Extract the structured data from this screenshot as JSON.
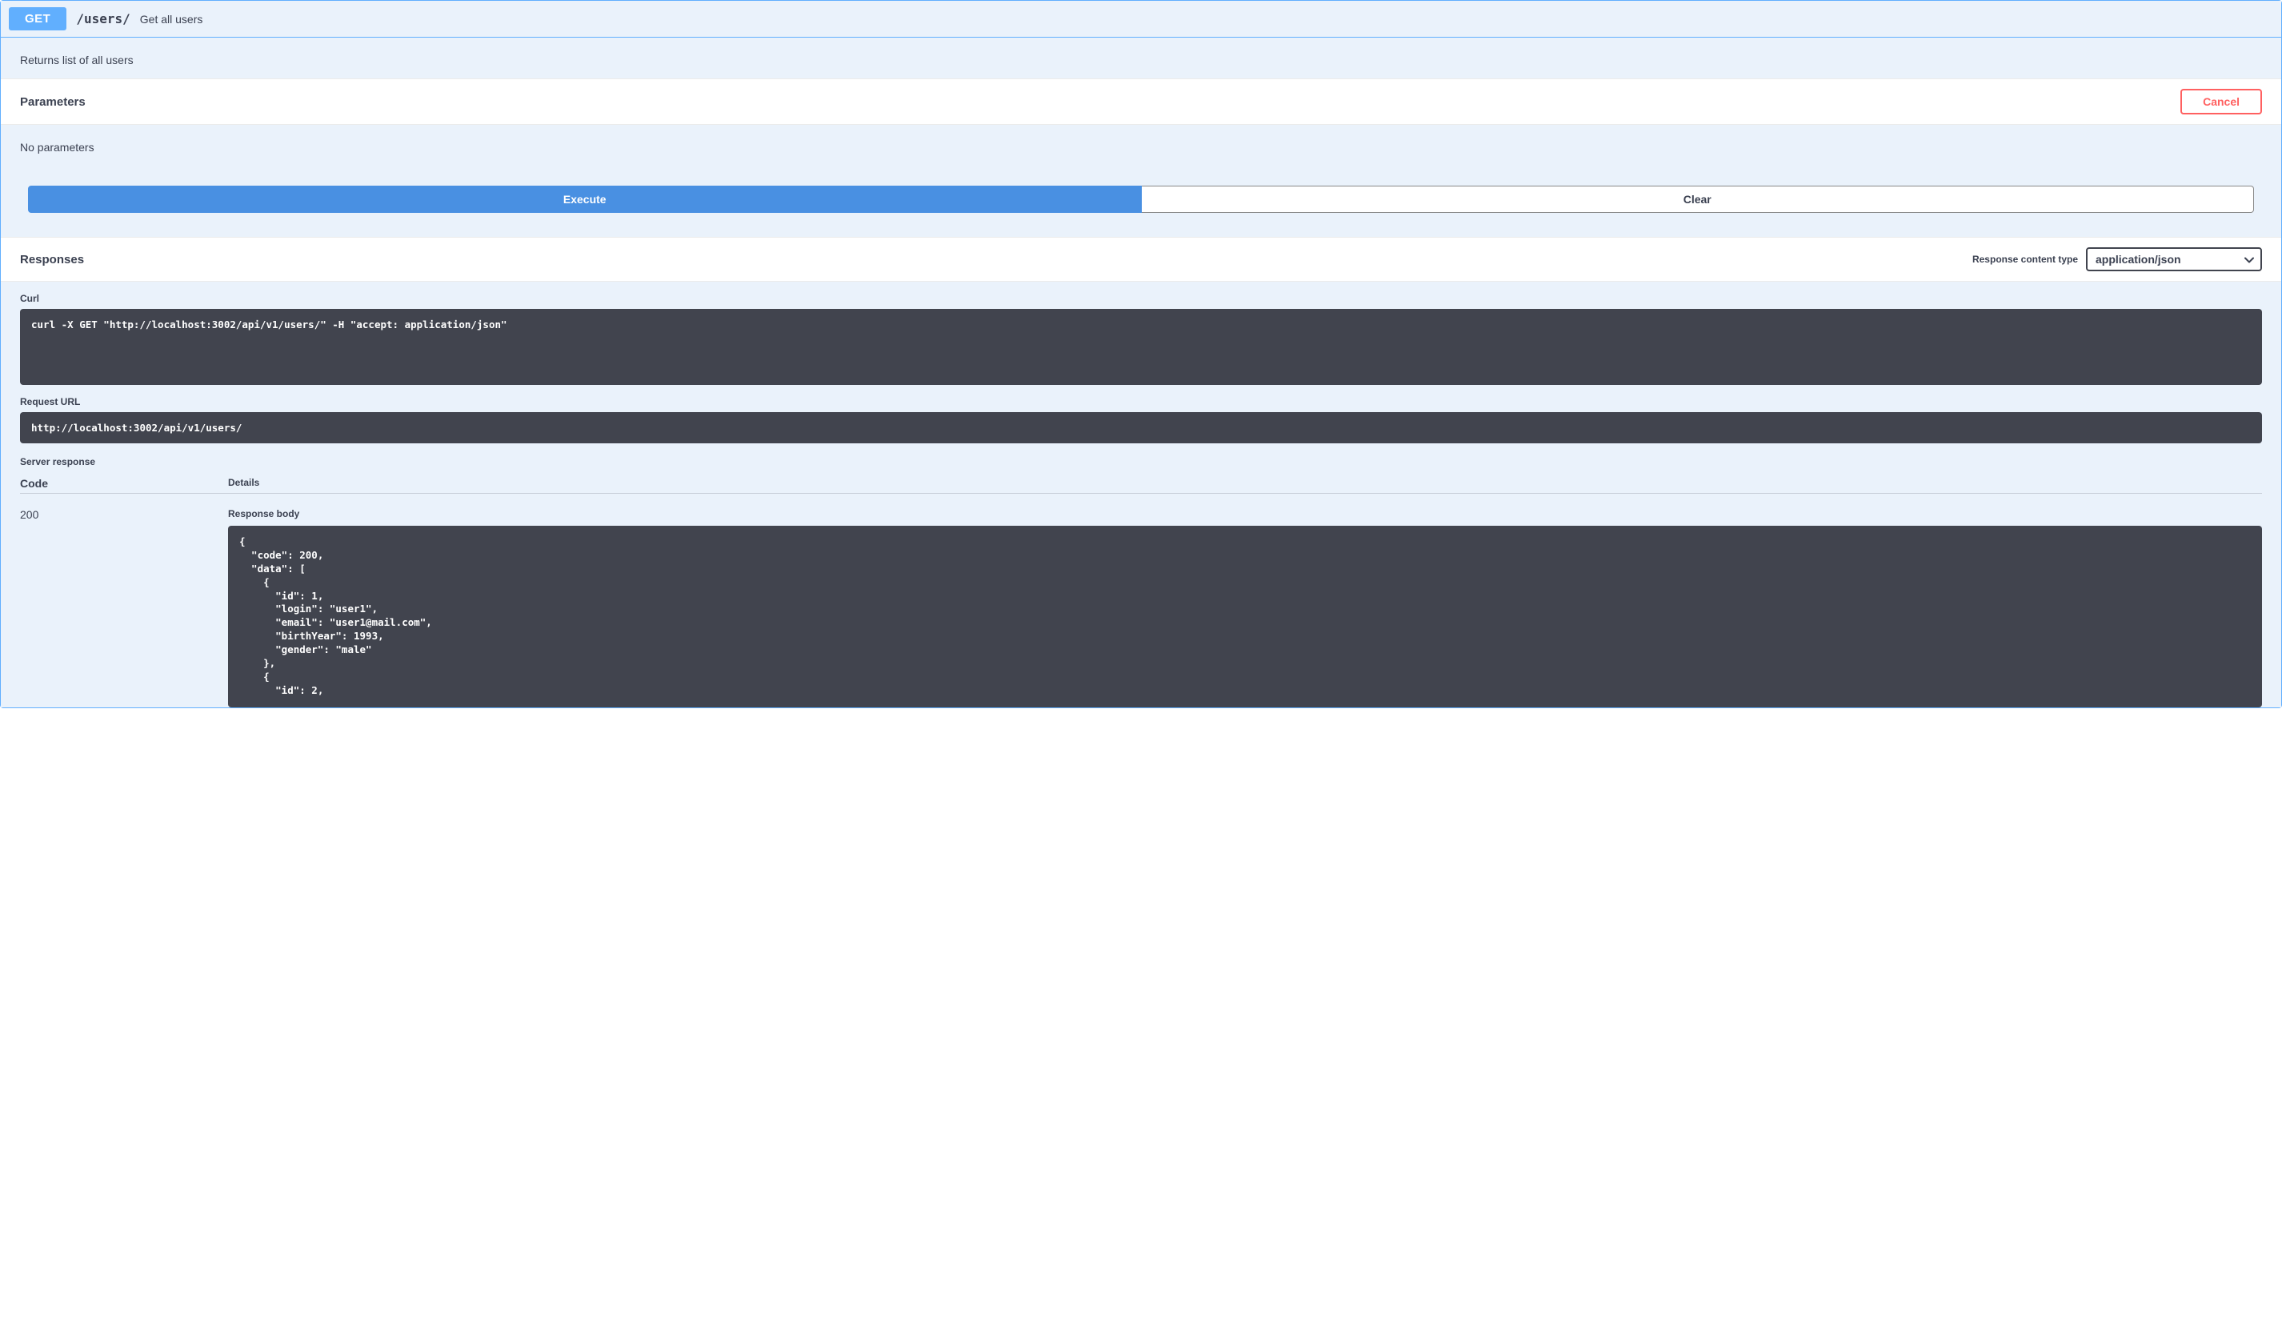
{
  "endpoint": {
    "method": "GET",
    "path": "/users/",
    "summary": "Get all users",
    "description": "Returns list of all users"
  },
  "sections": {
    "parameters_title": "Parameters",
    "cancel_label": "Cancel",
    "no_params": "No parameters",
    "execute_label": "Execute",
    "clear_label": "Clear",
    "responses_title": "Responses",
    "content_type_label": "Response content type",
    "content_type_value": "application/json"
  },
  "labels": {
    "curl": "Curl",
    "request_url": "Request URL",
    "server_response": "Server response",
    "code": "Code",
    "details": "Details",
    "response_body": "Response body"
  },
  "curl_command": "curl -X GET \"http://localhost:3002/api/v1/users/\" -H \"accept: application/json\"",
  "request_url": "http://localhost:3002/api/v1/users/",
  "response": {
    "code": "200",
    "body": "{\n  \"code\": 200,\n  \"data\": [\n    {\n      \"id\": 1,\n      \"login\": \"user1\",\n      \"email\": \"user1@mail.com\",\n      \"birthYear\": 1993,\n      \"gender\": \"male\"\n    },\n    {\n      \"id\": 2,"
  }
}
